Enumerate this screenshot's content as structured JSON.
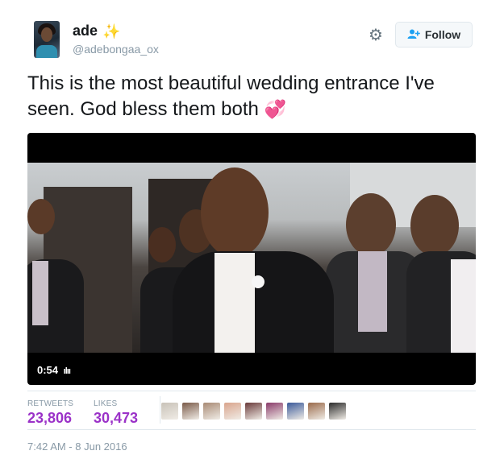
{
  "user": {
    "name": "ade",
    "handle": "@adebongaa_ox",
    "sparkle_icon": "✨"
  },
  "follow_button": {
    "label": "Follow",
    "icon": "add-user-icon"
  },
  "tweet": {
    "text": "This is the most beautiful wedding entrance I've seen. God bless them both",
    "emoji": "💞"
  },
  "video": {
    "duration": "0:54"
  },
  "stats": {
    "retweets_label": "RETWEETS",
    "retweets_value": "23,806",
    "likes_label": "LIKES",
    "likes_value": "30,473"
  },
  "likers_colors": [
    "#c8c2b8",
    "#7a5a48",
    "#a88a74",
    "#d9a48c",
    "#6a3a3a",
    "#8a3a6a",
    "#3a5a9a",
    "#9a6a4a",
    "#2a2a2a"
  ],
  "timestamp": "7:42 AM - 8 Jun 2016",
  "colors": {
    "accent": "#1da1f2",
    "stat_purple": "#9b32c8",
    "muted": "#8899a6"
  }
}
